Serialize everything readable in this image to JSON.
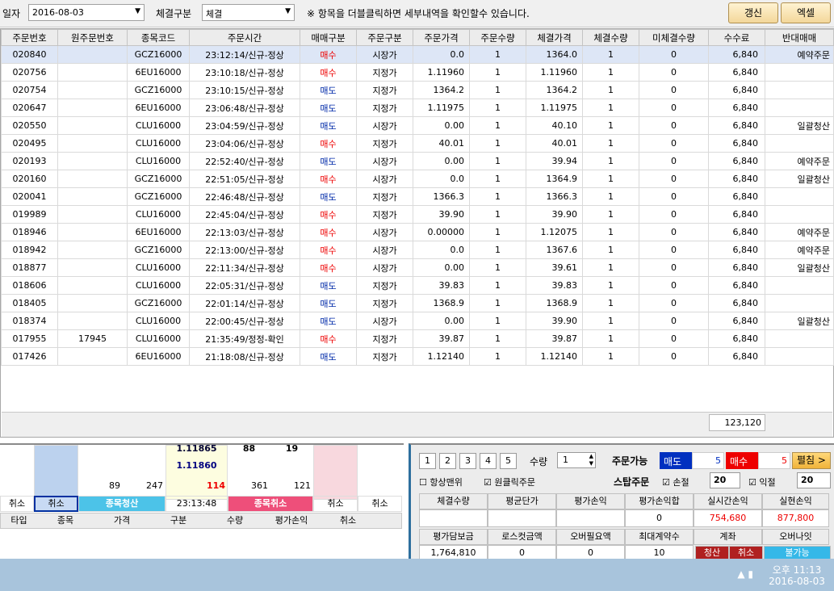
{
  "toolbar": {
    "date_label": "일자",
    "date_value": "2016-08-03",
    "filter_label": "체결구분",
    "filter_value": "체결",
    "notice": "※ 항목을 더블클릭하면 세부내역을 확인할수 있습니다.",
    "refresh": "갱신",
    "excel": "엑셀"
  },
  "columns": [
    "주문번호",
    "원주문번호",
    "종목코드",
    "주문시간",
    "매매구분",
    "주문구분",
    "주문가격",
    "주문수량",
    "체결가격",
    "체결수량",
    "미체결수량",
    "수수료",
    "반대매매"
  ],
  "rows": [
    [
      "020840",
      "",
      "GCZ16000",
      "23:12:14/신규-정상",
      "매수",
      "시장가",
      "0.0",
      "1",
      "1364.0",
      "1",
      "0",
      "6,840",
      "예약주문"
    ],
    [
      "020756",
      "",
      "6EU16000",
      "23:10:18/신규-정상",
      "매수",
      "지정가",
      "1.11960",
      "1",
      "1.11960",
      "1",
      "0",
      "6,840",
      ""
    ],
    [
      "020754",
      "",
      "GCZ16000",
      "23:10:15/신규-정상",
      "매도",
      "지정가",
      "1364.2",
      "1",
      "1364.2",
      "1",
      "0",
      "6,840",
      ""
    ],
    [
      "020647",
      "",
      "6EU16000",
      "23:06:48/신규-정상",
      "매도",
      "지정가",
      "1.11975",
      "1",
      "1.11975",
      "1",
      "0",
      "6,840",
      ""
    ],
    [
      "020550",
      "",
      "CLU16000",
      "23:04:59/신규-정상",
      "매도",
      "시장가",
      "0.00",
      "1",
      "40.10",
      "1",
      "0",
      "6,840",
      "일괄청산"
    ],
    [
      "020495",
      "",
      "CLU16000",
      "23:04:06/신규-정상",
      "매수",
      "지정가",
      "40.01",
      "1",
      "40.01",
      "1",
      "0",
      "6,840",
      ""
    ],
    [
      "020193",
      "",
      "CLU16000",
      "22:52:40/신규-정상",
      "매도",
      "시장가",
      "0.00",
      "1",
      "39.94",
      "1",
      "0",
      "6,840",
      "예약주문"
    ],
    [
      "020160",
      "",
      "GCZ16000",
      "22:51:05/신규-정상",
      "매수",
      "시장가",
      "0.0",
      "1",
      "1364.9",
      "1",
      "0",
      "6,840",
      "일괄청산"
    ],
    [
      "020041",
      "",
      "GCZ16000",
      "22:46:48/신규-정상",
      "매도",
      "지정가",
      "1366.3",
      "1",
      "1366.3",
      "1",
      "0",
      "6,840",
      ""
    ],
    [
      "019989",
      "",
      "CLU16000",
      "22:45:04/신규-정상",
      "매수",
      "지정가",
      "39.90",
      "1",
      "39.90",
      "1",
      "0",
      "6,840",
      ""
    ],
    [
      "018946",
      "",
      "6EU16000",
      "22:13:03/신규-정상",
      "매수",
      "시장가",
      "0.00000",
      "1",
      "1.12075",
      "1",
      "0",
      "6,840",
      "예약주문"
    ],
    [
      "018942",
      "",
      "GCZ16000",
      "22:13:00/신규-정상",
      "매수",
      "시장가",
      "0.0",
      "1",
      "1367.6",
      "1",
      "0",
      "6,840",
      "예약주문"
    ],
    [
      "018877",
      "",
      "CLU16000",
      "22:11:34/신규-정상",
      "매수",
      "시장가",
      "0.00",
      "1",
      "39.61",
      "1",
      "0",
      "6,840",
      "일괄청산"
    ],
    [
      "018606",
      "",
      "CLU16000",
      "22:05:31/신규-정상",
      "매도",
      "지정가",
      "39.83",
      "1",
      "39.83",
      "1",
      "0",
      "6,840",
      ""
    ],
    [
      "018405",
      "",
      "GCZ16000",
      "22:01:14/신규-정상",
      "매도",
      "지정가",
      "1368.9",
      "1",
      "1368.9",
      "1",
      "0",
      "6,840",
      ""
    ],
    [
      "018374",
      "",
      "CLU16000",
      "22:00:45/신규-정상",
      "매도",
      "시장가",
      "0.00",
      "1",
      "39.90",
      "1",
      "0",
      "6,840",
      "일괄청산"
    ],
    [
      "017955",
      "17945",
      "CLU16000",
      "21:35:49/정정-확인",
      "매수",
      "지정가",
      "39.87",
      "1",
      "39.87",
      "1",
      "0",
      "6,840",
      ""
    ],
    [
      "017426",
      "",
      "6EU16000",
      "21:18:08/신규-정상",
      "매도",
      "지정가",
      "1.12140",
      "1",
      "1.12140",
      "1",
      "0",
      "6,840",
      ""
    ]
  ],
  "total_fee": "123,120",
  "left_panel": {
    "price1": "1.11865",
    "v1": "88",
    "v2": "19",
    "price2": "1.11860",
    "n89": "89",
    "n247": "247",
    "n114": "114",
    "n361": "361",
    "n121": "121",
    "cancel": "취소",
    "cancel2": "취소",
    "clear_item": "종목청산",
    "time": "23:13:48",
    "cancel_item": "종목취소",
    "cancel3": "취소",
    "cancel4": "취소",
    "cols": [
      "타입",
      "종목",
      "가격",
      "구분",
      "수량",
      "평가손익",
      "취소"
    ]
  },
  "right_panel": {
    "nums": [
      "1",
      "2",
      "3",
      "4",
      "5"
    ],
    "qty_label": "수량",
    "qty": "1",
    "avail_label": "주문가능",
    "sell_label": "매도",
    "sell_val": "5",
    "buy_label": "매수",
    "buy_val": "5",
    "expand": "펼침 >",
    "always_top": "항상맨위",
    "one_click": "원클릭주문",
    "stop_label": "스탑주문",
    "stoploss": "손절",
    "sl_val": "20",
    "takeprofit": "익절",
    "tp_val": "20",
    "h1": [
      "체결수량",
      "평균단가",
      "평가손익",
      "평가손익합",
      "실시간손익",
      "실현손익"
    ],
    "v1": [
      "",
      "",
      "",
      "0",
      "754,680",
      "877,800"
    ],
    "h2": [
      "평가담보금",
      "로스컷금액",
      "오버필요액",
      "최대계약수",
      "계좌",
      "오버나잇"
    ],
    "v2": [
      "1,764,810",
      "0",
      "0",
      "10"
    ],
    "acct_clear": "청산",
    "acct_cancel": "취소",
    "overnight": "불가능"
  },
  "clock": {
    "time": "오후 11:13",
    "date": "2016-08-03"
  }
}
